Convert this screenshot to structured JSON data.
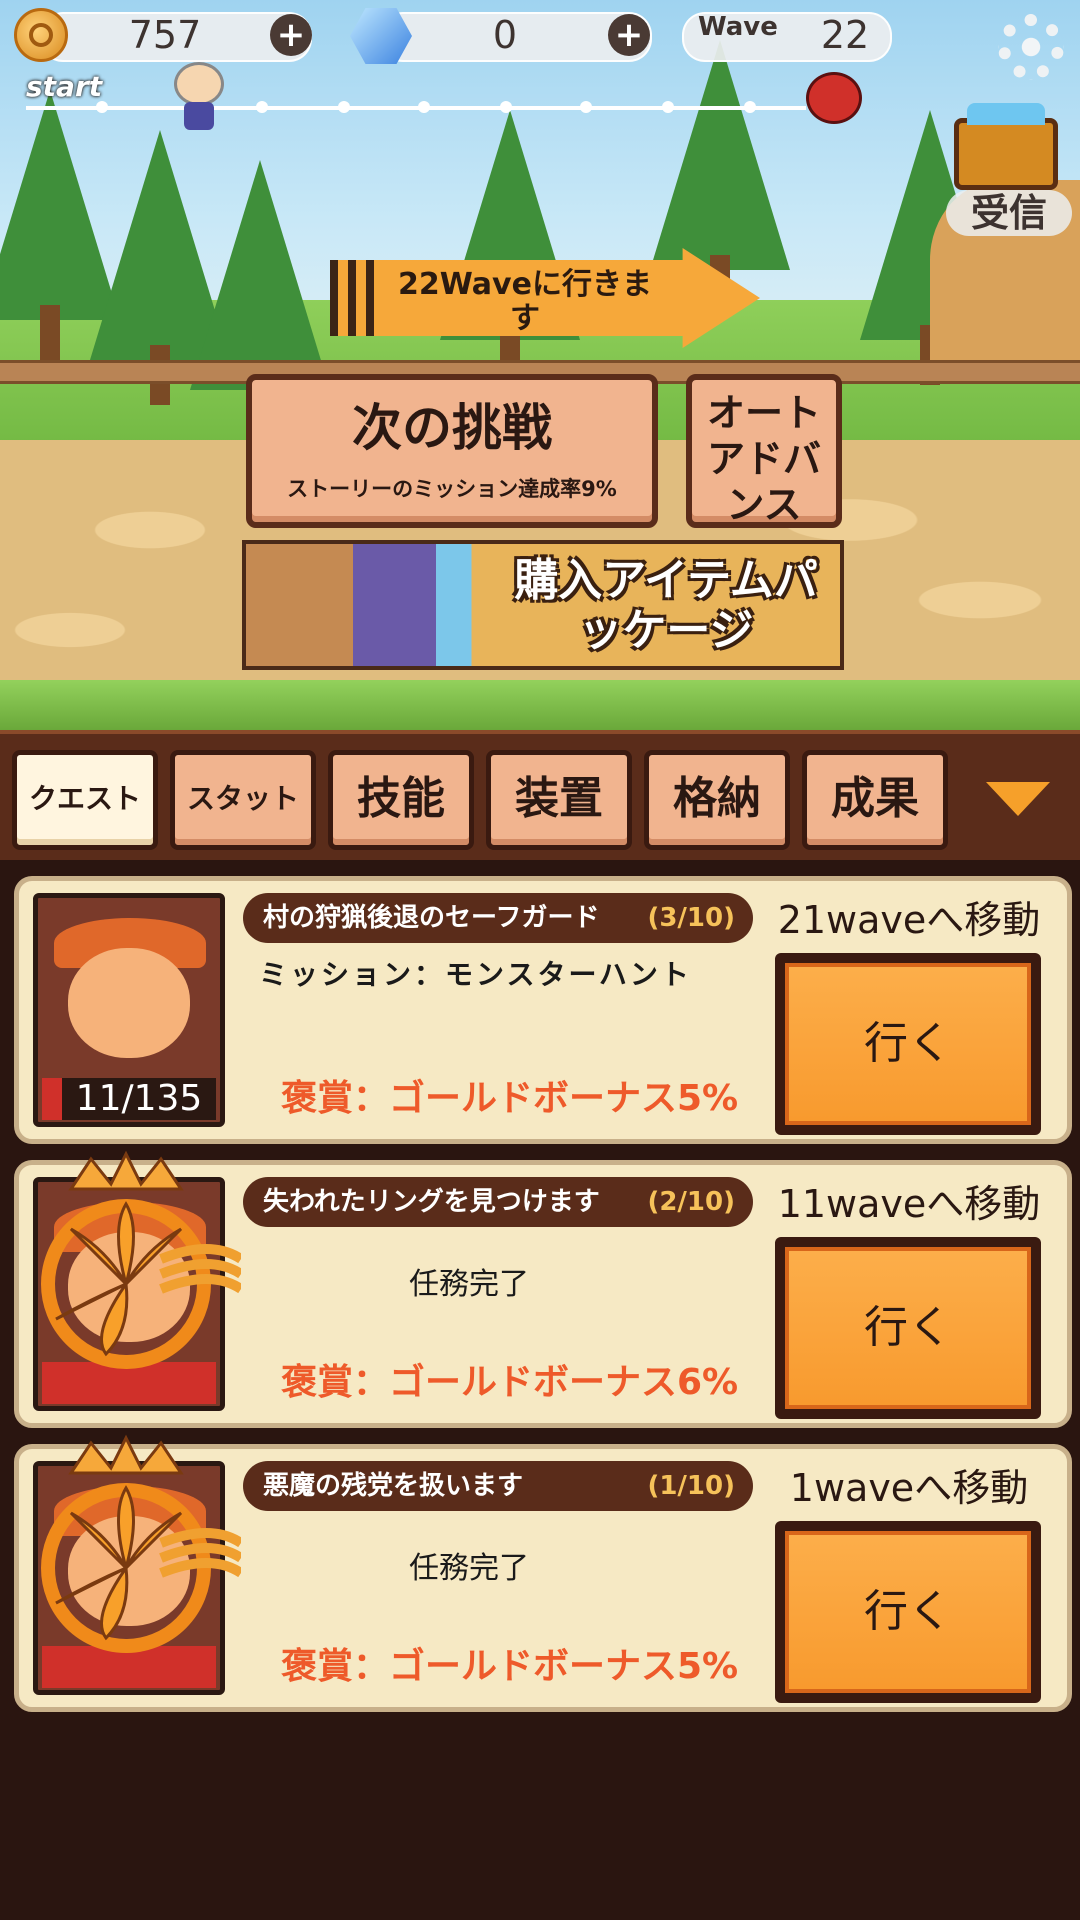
{
  "hud": {
    "gold": "757",
    "gems": "0",
    "wave_label": "Wave",
    "wave_value": "22",
    "start_label": "start",
    "receive_label": "受信"
  },
  "scene": {
    "wave_banner": "22Waveに行きます",
    "challenge_title": "次の挑戦",
    "challenge_subtitle": "ストーリーのミッション達成率9%",
    "auto_advance": "オートアドバンス",
    "package_banner": "購入アイテムパッケージ"
  },
  "tabs": [
    {
      "label": "クエスト",
      "active": true
    },
    {
      "label": "スタット",
      "active": false
    },
    {
      "label": "技能",
      "active": false
    },
    {
      "label": "装置",
      "active": false
    },
    {
      "label": "格納",
      "active": false
    },
    {
      "label": "成果",
      "active": false
    }
  ],
  "quests": [
    {
      "title": "村の狩猟後退のセーフガード",
      "progress": "(3/10)",
      "mission": "ミッション：モンスターハント",
      "count": "11/135",
      "reward": "褒賞：ゴールドボーナス5%",
      "move": "21waveへ移動",
      "go": "行く"
    },
    {
      "title": "失われたリングを見つけます",
      "progress": "(2/10)",
      "status": "任務完了",
      "reward": "褒賞：ゴールドボーナス6%",
      "move": "11waveへ移動",
      "go": "行く"
    },
    {
      "title": "悪魔の残党を扱います",
      "progress": "(1/10)",
      "status": "任務完了",
      "reward": "褒賞：ゴールドボーナス5%",
      "move": "1waveへ移動",
      "go": "行く"
    }
  ],
  "colors": {
    "accent_orange": "#f89a2e",
    "panel_brown": "#5a2c1a",
    "reward_red": "#ee5a2a"
  }
}
